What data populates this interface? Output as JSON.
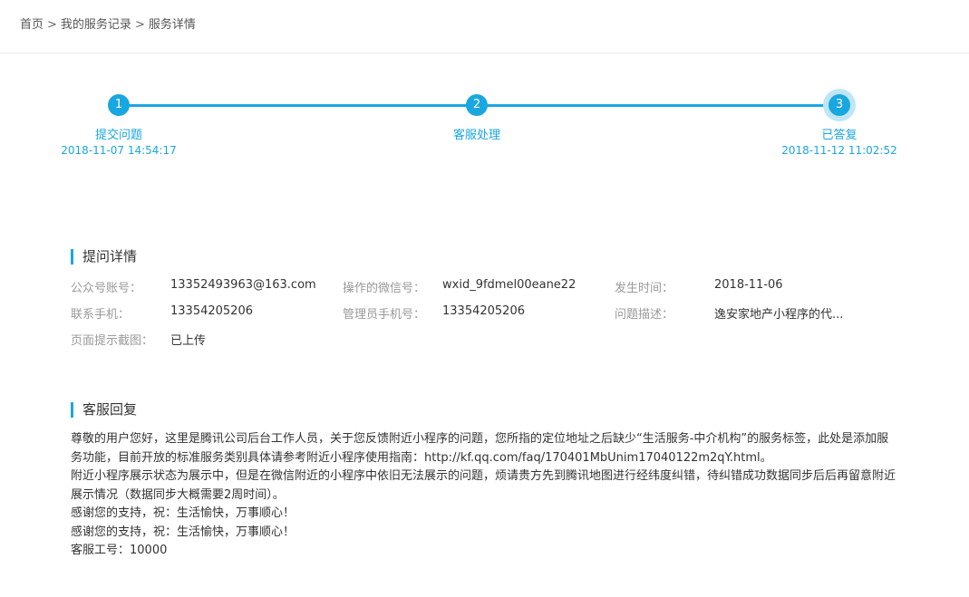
{
  "breadcrumb": {
    "home": "首页",
    "records": "我的服务记录",
    "current": "服务详情",
    "separator": ">"
  },
  "progress": {
    "steps": [
      {
        "number": "1",
        "label": "提交问题",
        "time": "2018-11-07 14:54:17"
      },
      {
        "number": "2",
        "label": "客服处理",
        "time": ""
      },
      {
        "number": "3",
        "label": "已答复",
        "time": "2018-11-12 11:02:52"
      }
    ],
    "accent_color": "#18a7e0"
  },
  "details": {
    "title": "提问详情",
    "fields": {
      "account": {
        "label": "公众号账号：",
        "value": "13352493963@163.com"
      },
      "wechat_id": {
        "label": "操作的微信号：",
        "value": "wxid_9fdmel00eane22"
      },
      "date": {
        "label": "发生时间：",
        "value": "2018-11-06"
      },
      "phone": {
        "label": "联系手机：",
        "value": "13354205206"
      },
      "admin_phone": {
        "label": "管理员手机号：",
        "value": "13354205206"
      },
      "description": {
        "label": "问题描述：",
        "value": "逸安家地产小程序的代..."
      },
      "screenshot": {
        "label": "页面提示截图：",
        "value": "已上传"
      }
    }
  },
  "reply": {
    "title": "客服回复",
    "lines": [
      "尊敬的用户您好，这里是腾讯公司后台工作人员，关于您反馈附近小程序的问题，您所指的定位地址之后缺少“生活服务-中介机构”的服务标签，此处是添加服务功能，目前开放的标准服务类别具体请参考附近小程序使用指南：http://kf.qq.com/faq/170401MbUnim17040122m2qY.html。",
      "附近小程序展示状态为展示中，但是在微信附近的小程序中依旧无法展示的问题，烦请贵方先到腾讯地图进行经纬度纠错，待纠错成功数据同步后后再留意附近展示情况（数据同步大概需要2周时间）。",
      "感谢您的支持，祝：生活愉快，万事顺心！",
      "感谢您的支持，祝：生活愉快，万事顺心！",
      "客服工号：10000"
    ]
  }
}
